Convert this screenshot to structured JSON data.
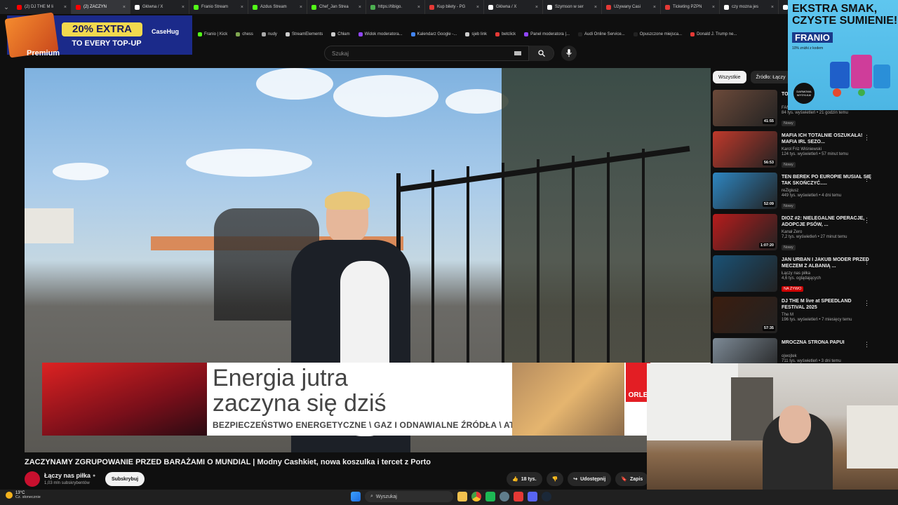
{
  "tabs": [
    {
      "label": "(2) DJ THE M li",
      "color": "#ff0000",
      "active": false
    },
    {
      "label": "(2) ZACZYN",
      "color": "#ff0000",
      "active": true
    },
    {
      "label": "Główna / X",
      "color": "#ffffff",
      "active": false
    },
    {
      "label": "Franio Stream",
      "color": "#53fc18",
      "active": false
    },
    {
      "label": "Azdus Stream",
      "color": "#53fc18",
      "active": false
    },
    {
      "label": "Chef_Jan Strea",
      "color": "#53fc18",
      "active": false
    },
    {
      "label": "https://tibigo.",
      "color": "#4caf50",
      "active": false
    },
    {
      "label": "Kup bilety - PG",
      "color": "#e53935",
      "active": false
    },
    {
      "label": "Główna / X",
      "color": "#ffffff",
      "active": false
    },
    {
      "label": "Szymson w ser",
      "color": "#ffffff",
      "active": false
    },
    {
      "label": "Używany Casi",
      "color": "#e53935",
      "active": false
    },
    {
      "label": "Ticketing PZPN",
      "color": "#e53935",
      "active": false
    },
    {
      "label": "czy mozna jes",
      "color": "#ffffff",
      "active": false
    },
    {
      "label": "(40)król maksy",
      "color": "#ffffff",
      "active": false
    },
    {
      "label": "ozsu",
      "color": "#ffffff",
      "active": false
    }
  ],
  "bookmarks": [
    {
      "label": "Franio | Kick",
      "color": "#53fc18"
    },
    {
      "label": "chess",
      "color": "#7fa650"
    },
    {
      "label": "nudy",
      "color": "#aaaaaa"
    },
    {
      "label": "StreamElements",
      "color": "#cccccc"
    },
    {
      "label": "Chłam",
      "color": "#cccccc"
    },
    {
      "label": "Widok moderatora...",
      "color": "#9146ff"
    },
    {
      "label": "Kalendarz Google -...",
      "color": "#4285f4"
    },
    {
      "label": "sjeb link",
      "color": "#cccccc"
    },
    {
      "label": "betclick",
      "color": "#e53935"
    },
    {
      "label": "Panel moderatora |...",
      "color": "#9146ff"
    },
    {
      "label": "Audi Online Service...",
      "color": "#222222"
    },
    {
      "label": "Opuszczone miejsca...",
      "color": "#222222"
    },
    {
      "label": "Donald J. Trump ne...",
      "color": "#e53935"
    }
  ],
  "casehug": {
    "pill": "20% EXTRA",
    "sub": "TO EVERY TOP-UP",
    "brand": "CaseHug"
  },
  "header": {
    "logo": "Premium",
    "search_placeholder": "Szukaj"
  },
  "ad": {
    "line1": "Energia jutra",
    "line2": "zaczyna się dziś",
    "line3": "BEZPIECZEŃSTWO ENERGETYCZNE  \\  GAZ I ODNAWIALNE ŹRÓDŁA  \\  ATOM",
    "logo": "ORLE"
  },
  "video": {
    "title": "ZACZYNAMY ZGRUPOWANIE PRZED BARAŻAMI O MUNDIAL | Modny Cashkiet, nowa koszulka i tercet z Porto",
    "channel": "Łączy nas piłka",
    "subs": "1,03 mln subskrybentów",
    "subscribe": "Subskrybuj",
    "likes": "18 tys.",
    "share": "Udostępnij",
    "save": "Zapis"
  },
  "sidebar": {
    "chips": [
      "Wszystkie",
      "Źródło: Łączy"
    ],
    "items": [
      {
        "title": "TO VI",
        "channel": "FAME MMA",
        "stats": "84 tys. wyświetleń • 21 godzin temu",
        "badge": "Nowy",
        "dur": "41:55",
        "thumb": "#6c4a3a"
      },
      {
        "title": "MAFIA ICH TOTALNIE OSZUKAŁA! MAFIA IRL SEZO...",
        "channel": "Karol Friz Wiśniewski",
        "stats": "124 tys. wyświetleń • 57 minut temu",
        "badge": "Nowy",
        "dur": "56:53",
        "thumb": "#c0392b"
      },
      {
        "title": "TEN BEREK PO EUROPIE MUSIAŁ SIĘ TAK SKOŃCZYĆ.....",
        "channel": "reZigiusz",
        "stats": "449 tys. wyświetleń • 4 dni temu",
        "badge": "Nowy",
        "dur": "52:09",
        "thumb": "#2e86c1"
      },
      {
        "title": "DIOZ #2: NIELEGALNE OPERACJE, ADOPCJE PSÓW, ...",
        "channel": "Kanał Zero",
        "stats": "7,2 tys. wyświetleń • 27 minut temu",
        "badge": "Nowy",
        "dur": "1:07:20",
        "thumb": "#b71c1c"
      },
      {
        "title": "JAN URBAN I JAKUB MODER PRZED MECZEM Z ALBANIĄ ...",
        "channel": "Łączy nas piłka",
        "stats": "4,6 tys. oglądających",
        "badge": "NA ŻYWO",
        "dur": "",
        "thumb": "#1a5276"
      },
      {
        "title": "DJ THE M live at SPEEDLAND FESTIVAL 2025",
        "channel": "The M",
        "stats": "196 tys. wyświetleń • 7 miesięcy temu",
        "badge": "",
        "dur": "57:35",
        "thumb": "#3b1d0f"
      },
      {
        "title": "MROCZNA STRONA PAPUI",
        "channel": "ojwojtek",
        "stats": "711 tys. wyświetleń • 3 dni temu",
        "badge": "Nowy",
        "dur": "",
        "thumb": "#7d8a96"
      }
    ]
  },
  "franio_ad": {
    "headline1": "EKSTRA SMAK,",
    "headline2": "CZYSTE SUMIENIE!",
    "brand": "FRANIO",
    "tagline": "10% zniżki z kodem",
    "circle": "DARMOWA WYSYŁKA!"
  },
  "taskbar": {
    "temp": "13°C",
    "weather": "Cz. słonecznie",
    "search": "Wyszukaj"
  }
}
